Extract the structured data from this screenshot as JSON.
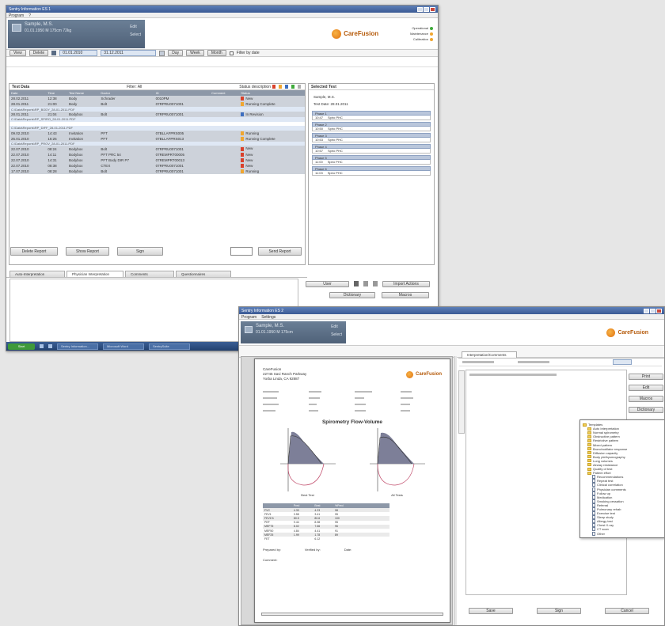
{
  "colors": {
    "accent": "#e0700f",
    "header_blue": "#3a5a94",
    "grid_head": "#8d98a8",
    "status_red": "#d9412b",
    "status_orange": "#f0a630",
    "status_blue": "#3e6fc0"
  },
  "win1": {
    "title": "Sentry Information ES 1",
    "menu": [
      "Program",
      "?"
    ],
    "patient": {
      "name": "Sample, M.S.",
      "info": "01.01.1950  M  175cm  72kg",
      "link1": "Edit",
      "link2": "Select"
    },
    "logo": "CareFusion",
    "status": [
      {
        "label": "Operational",
        "color": "#3faa3a"
      },
      {
        "label": "Maintenance",
        "color": "#f0a630"
      },
      {
        "label": "Calibration",
        "color": "#f0a630"
      }
    ],
    "toolbar": {
      "view": "View",
      "delete": "Delete",
      "date_from": "01.01.2010",
      "date_to": "31.12.2011",
      "day": "Day",
      "week": "Week",
      "month": "Month",
      "filter": "Filter by date"
    },
    "grid": {
      "title": "Test Data",
      "subtitle": "Filter: All",
      "status_label": "Status description",
      "headers": [
        "Date",
        "Time",
        "Test Name",
        "Doctor",
        "ID",
        "Comment",
        "Status"
      ],
      "rows": [
        {
          "date": "28.02.2011",
          "time": "12:38",
          "test": "Body",
          "doctor": "Schrader",
          "id": "0010PM",
          "status": "New",
          "color": "#d9412b",
          "sub": ""
        },
        {
          "date": "28.01.2011",
          "time": "21:00",
          "test": "Body",
          "doctor": "Bolt",
          "id": "07RPRU0071001",
          "status": "Running Complete",
          "color": "#f0a630",
          "sub": "C:\\Data\\Reports\\RP_BODY_28-01-2011.PDF"
        },
        {
          "date": "28.01.2011",
          "time": "21:04",
          "test": "Bodybox",
          "doctor": "Bolt",
          "id": "07RPRU0071001",
          "status": "In Revision",
          "color": "#3e6fc0",
          "sub": "C:\\Data\\Reports\\RP_SPIRO_28-01-2011.PDF"
        },
        {
          "date": "",
          "time": "",
          "test": "",
          "doctor": "",
          "id": "",
          "status": "",
          "color": "",
          "sub": "C:\\Data\\Reports\\RP_DIFF_28-01-2011.PDF"
        },
        {
          "date": "09.02.2010",
          "time": "14:43",
          "test": "Invitation",
          "doctor": "PFT",
          "id": "07BLLAFPRS005",
          "status": "Running",
          "color": "#f0a630",
          "sub": ""
        },
        {
          "date": "25.01.2010",
          "time": "16:25",
          "test": "Invitation",
          "doctor": "PFT",
          "id": "07BLLAFPRS013",
          "status": "Running Complete",
          "color": "#f0a630",
          "sub": "C:\\Data\\Reports\\RP_PROV_28-01-2011.PDF"
        },
        {
          "date": "22.07.2010",
          "time": "08:24",
          "test": "Bodybox",
          "doctor": "Bolt",
          "id": "07RPRU0071001",
          "status": "New",
          "color": "#d9412b",
          "sub": ""
        },
        {
          "date": "22.07.2010",
          "time": "14:11",
          "test": "Bodybox",
          "doctor": "PFT PRC 54",
          "id": "07REMPRT00005",
          "status": "New",
          "color": "#d9412b",
          "sub": ""
        },
        {
          "date": "22.07.2010",
          "time": "14:31",
          "test": "Bodybox",
          "doctor": "PFT Body DIR P7",
          "id": "07REMPRT00013",
          "status": "New",
          "color": "#d9412b",
          "sub": ""
        },
        {
          "date": "22.07.2010",
          "time": "08:38",
          "test": "Bodybox",
          "doctor": "CTEX",
          "id": "07RPRU0071001",
          "status": "New",
          "color": "#d9412b",
          "sub": ""
        },
        {
          "date": "17.07.2010",
          "time": "08:28",
          "test": "Bodybox",
          "doctor": "Bolt",
          "id": "07RPRU0071001",
          "status": "Running",
          "color": "#f0a630",
          "sub": ""
        }
      ]
    },
    "buttons": {
      "delete_report": "Delete Report",
      "show_report": "Show Report",
      "sign": "Sign",
      "send_report": "Send Report"
    },
    "side": {
      "title": "Selected Test",
      "patient": "Sample, M.S.",
      "test_date": "Test Date: 28.01.2011",
      "days": [
        {
          "head": "Phase 1",
          "time": "10:47",
          "name": "Spiro PHC"
        },
        {
          "head": "Phase 2",
          "time": "10:50",
          "name": "Spiro PHC"
        },
        {
          "head": "Phase 3",
          "time": "10:53",
          "name": "Spiro PHC"
        },
        {
          "head": "Phase 4",
          "time": "10:57",
          "name": "Spiro PHC"
        },
        {
          "head": "Phase 5",
          "time": "11:00",
          "name": "Spiro PHC"
        },
        {
          "head": "Phase 6",
          "time": "11:03",
          "name": "Spiro PHC"
        }
      ]
    },
    "tabs": [
      "Auto-Interpretation",
      "Physician Interpretation",
      "Comments",
      "Questionnaires"
    ],
    "bottom_btns": {
      "user": "User",
      "import": "Import Actions",
      "dictionary": "Dictionary",
      "macros": "Macros"
    },
    "taskbar": {
      "start": "Start",
      "items": [
        "Sentry Information...",
        "Microsoft Word",
        "SentrySuite"
      ]
    }
  },
  "win2": {
    "title": "Sentry Information ES 2",
    "menu": [
      "Program",
      "Settings"
    ],
    "patient": {
      "name": "Sample, M.S.",
      "info": "01.01.1950  M  175cm",
      "link1": "Edit",
      "link2": "Select"
    },
    "logo": "CareFusion",
    "report": {
      "clinic": "CareFusion",
      "address": "22745 Savi Ranch Parkway\nYorba Linda, CA 92887",
      "title": "Spirometry Flow-Volume",
      "pre": "Best Test",
      "post": "All Tests",
      "table_heads": [
        "",
        "Pred",
        "Best",
        "%Pred",
        "",
        "",
        "",
        ""
      ],
      "table_rows": [
        [
          "FVC",
          "4.33",
          "4.23",
          "98",
          "",
          "",
          "",
          ""
        ],
        [
          "FEV1",
          "3.58",
          "3.41",
          "95",
          "",
          "",
          "",
          ""
        ],
        [
          "FEV1%",
          "80.5",
          "80.6",
          "100",
          "",
          "",
          "",
          ""
        ],
        [
          "PEF",
          "9.44",
          "8.98",
          "95",
          "",
          "",
          "",
          ""
        ],
        [
          "MEF75",
          "8.02",
          "7.66",
          "96",
          "",
          "",
          "",
          ""
        ],
        [
          "MEF50",
          "4.84",
          "4.41",
          "91",
          "",
          "",
          "",
          ""
        ],
        [
          "MEF25",
          "1.99",
          "1.78",
          "89",
          "",
          "",
          "",
          ""
        ],
        [
          "FET",
          "",
          "6.12",
          "",
          "",
          "",
          "",
          ""
        ]
      ],
      "sign_labels": [
        "Prepared by:",
        "Verified by:",
        "Date:"
      ],
      "remarks": "Comment:"
    },
    "tab": "Interpretation/Comments",
    "side_btn_labels": [
      "Print",
      "Edit",
      "Macros",
      "Dictionary"
    ],
    "tree": {
      "title": "Templates",
      "items": [
        "Auto Interpretation",
        "Normal spirometry",
        "Obstructive pattern",
        "Restrictive pattern",
        "Mixed pattern",
        "Bronchodilator response",
        "Diffusion capacity",
        "Body plethysmography",
        "Lung volumes",
        "Airway resistance",
        "Quality of test",
        "Patient effort",
        "Recommendations",
        "Repeat test",
        "Clinical correlation",
        "Physician comments",
        "Follow up",
        "Medication",
        "Smoking cessation",
        "Referral",
        "Pulmonary rehab",
        "Exercise test",
        "Sleep study",
        "Allergy test",
        "Chest X-ray",
        "CT scan",
        "Other"
      ]
    },
    "footer_btns": [
      "Save",
      "Sign",
      "Cancel"
    ]
  }
}
